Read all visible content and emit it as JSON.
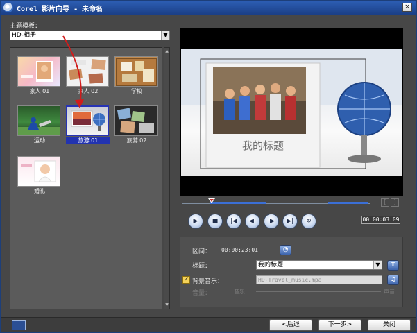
{
  "window": {
    "title": "Corel 影片向导 - 未命名",
    "close_label": "×"
  },
  "theme": {
    "label": "主题模板：",
    "selected": "HD-相册",
    "templates": [
      {
        "label": "家人 01",
        "icon": "family-thumbnail"
      },
      {
        "label": "家人 02",
        "icon": "family-collage-thumbnail"
      },
      {
        "label": "学校",
        "icon": "school-corkboard-thumbnail"
      },
      {
        "label": "运动",
        "icon": "sports-thumbnail"
      },
      {
        "label": "旅游 01",
        "icon": "travel-sunset-thumbnail",
        "selected": true
      },
      {
        "label": "旅游 02",
        "icon": "travel-photos-thumbnail"
      },
      {
        "label": "婚礼",
        "icon": "wedding-thumbnail"
      }
    ]
  },
  "preview": {
    "overlay_title": "我的标题",
    "timecode": "00:00:03.09"
  },
  "properties": {
    "duration_label": "区间：",
    "duration_value": "00:00:23:01",
    "title_label": "标题：",
    "title_value": "我的标题",
    "music_label": "背景音乐：",
    "music_value": "HD-Travel_music.mpa",
    "volume_label": "音量：",
    "music_tick": "音乐",
    "sound_tick": "声音"
  },
  "buttons": {
    "back": "<后退",
    "next": "下一步>",
    "close": "关闭"
  },
  "colors": {
    "selection": "#2233b0",
    "titlebar": "#2d5fb5",
    "arrow": "#d01c1c"
  }
}
